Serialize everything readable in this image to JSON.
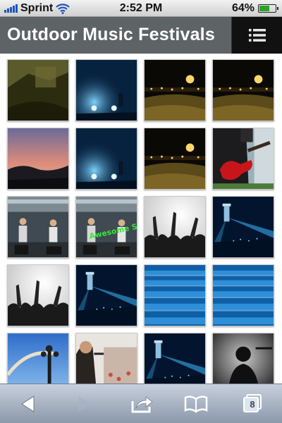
{
  "status_bar": {
    "carrier": "Sprint",
    "time": "2:52 PM",
    "battery_text": "64%",
    "battery_level": 0.64,
    "signal_bars": 5,
    "icons": [
      "signal-icon",
      "wifi-icon",
      "battery-icon"
    ]
  },
  "header": {
    "title": "Outdoor Music Festivals",
    "menu_icon": "list-menu-icon"
  },
  "gallery": {
    "items": [
      {
        "subject": "stage-silhouette-olive"
      },
      {
        "subject": "blue-stage-lights"
      },
      {
        "subject": "night-crowd-lights"
      },
      {
        "subject": "night-crowd-lights"
      },
      {
        "subject": "sunset-sky"
      },
      {
        "subject": "blue-stage-lights"
      },
      {
        "subject": "night-crowd-lights"
      },
      {
        "subject": "red-guitar-player"
      },
      {
        "subject": "band-on-stage"
      },
      {
        "subject": "band-on-stage-awesome-show"
      },
      {
        "subject": "crowd-hands-bw"
      },
      {
        "subject": "concert-lights-blue"
      },
      {
        "subject": "crowd-hands-bw"
      },
      {
        "subject": "concert-lights-blue"
      },
      {
        "subject": "empty-blue-seats"
      },
      {
        "subject": "empty-blue-seats"
      },
      {
        "subject": "lighting-rig-sky"
      },
      {
        "subject": "singer-and-crowd"
      },
      {
        "subject": "concert-lights-blue"
      },
      {
        "subject": "singer-silhouette-dark"
      }
    ],
    "overlay_text": "Awesome Show"
  },
  "toolbar": {
    "tabs_count": "8",
    "icons": [
      "back-arrow-icon",
      "forward-arrow-icon",
      "share-icon",
      "bookmarks-icon",
      "pages-icon"
    ]
  }
}
